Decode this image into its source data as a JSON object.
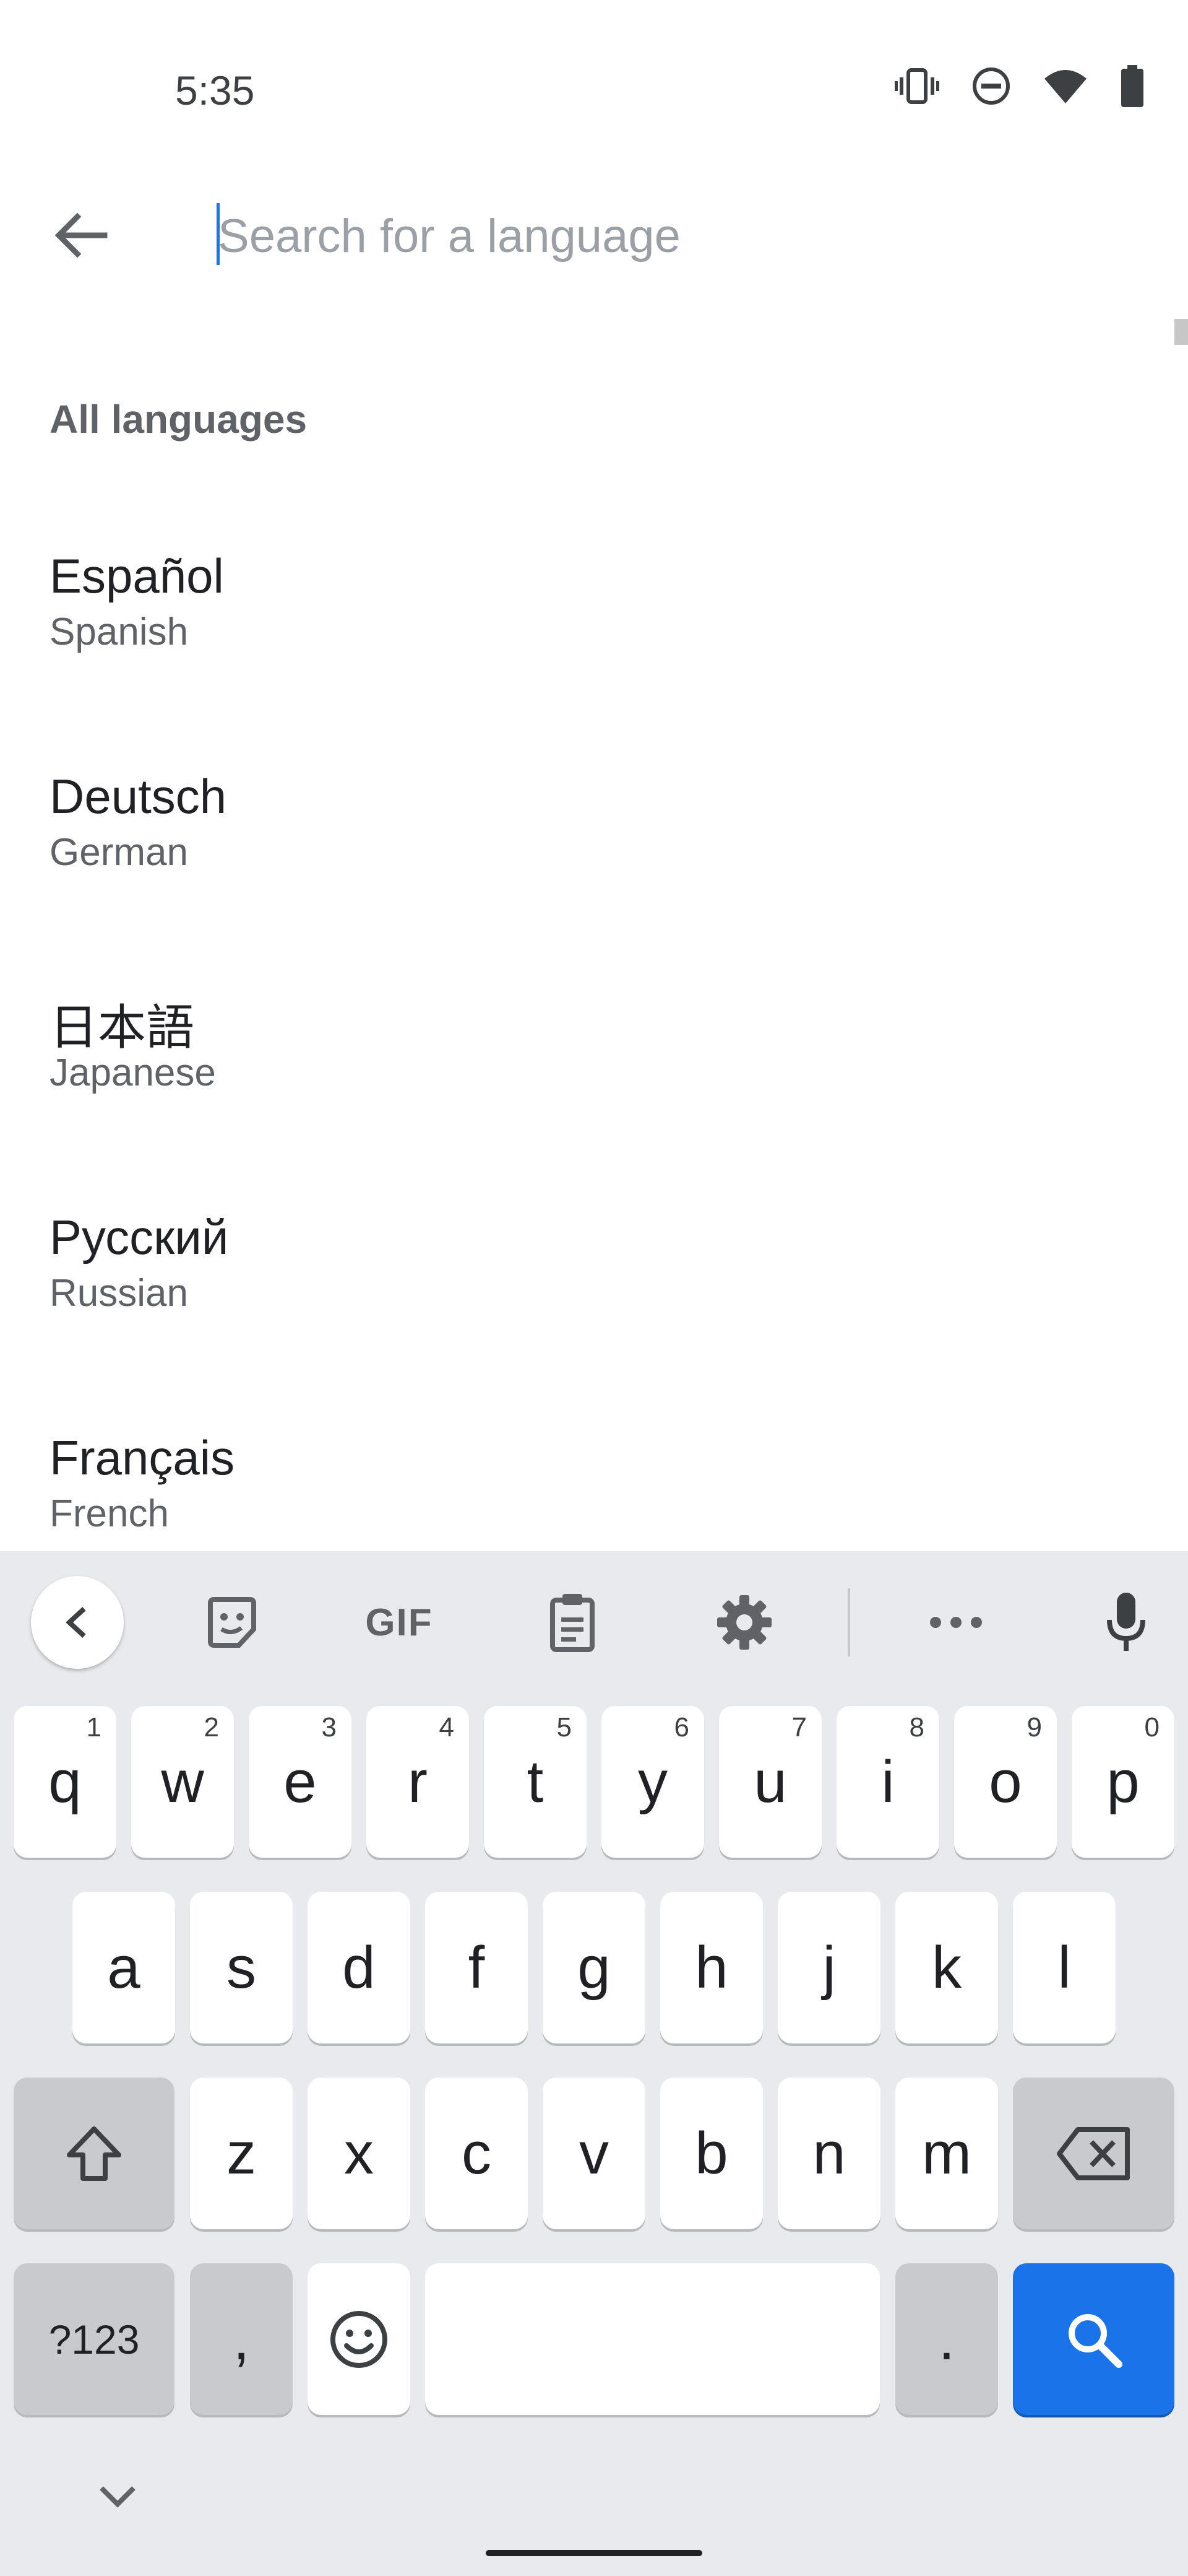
{
  "status": {
    "time": "5:35",
    "icons": [
      "vibrate-icon",
      "do-not-disturb-icon",
      "wifi-icon",
      "battery-icon"
    ]
  },
  "search": {
    "placeholder": "Search for a language",
    "value": ""
  },
  "list": {
    "section_title": "All languages",
    "items": [
      {
        "name": "Español",
        "subtitle": "Spanish"
      },
      {
        "name": "Deutsch",
        "subtitle": "German"
      },
      {
        "name": "日本語",
        "subtitle": "Japanese"
      },
      {
        "name": "Русский",
        "subtitle": "Russian"
      },
      {
        "name": "Français",
        "subtitle": "French"
      }
    ]
  },
  "keyboard": {
    "toolbar": {
      "gif_label": "GIF",
      "icons": [
        "chevron-left-icon",
        "sticker-icon",
        "gif-icon",
        "clipboard-icon",
        "settings-icon",
        "more-icon",
        "microphone-icon"
      ]
    },
    "row1": [
      {
        "char": "q",
        "hint": "1"
      },
      {
        "char": "w",
        "hint": "2"
      },
      {
        "char": "e",
        "hint": "3"
      },
      {
        "char": "r",
        "hint": "4"
      },
      {
        "char": "t",
        "hint": "5"
      },
      {
        "char": "y",
        "hint": "6"
      },
      {
        "char": "u",
        "hint": "7"
      },
      {
        "char": "i",
        "hint": "8"
      },
      {
        "char": "o",
        "hint": "9"
      },
      {
        "char": "p",
        "hint": "0"
      }
    ],
    "row2": [
      "a",
      "s",
      "d",
      "f",
      "g",
      "h",
      "j",
      "k",
      "l"
    ],
    "row3": [
      "z",
      "x",
      "c",
      "v",
      "b",
      "n",
      "m"
    ],
    "bottom": {
      "symbols_label": "?123",
      "comma_label": ",",
      "period_label": "."
    },
    "colors": {
      "background": "#e8eaed",
      "key": "#ffffff",
      "function_key": "#c8cace",
      "action_key": "#1a73e8"
    }
  }
}
